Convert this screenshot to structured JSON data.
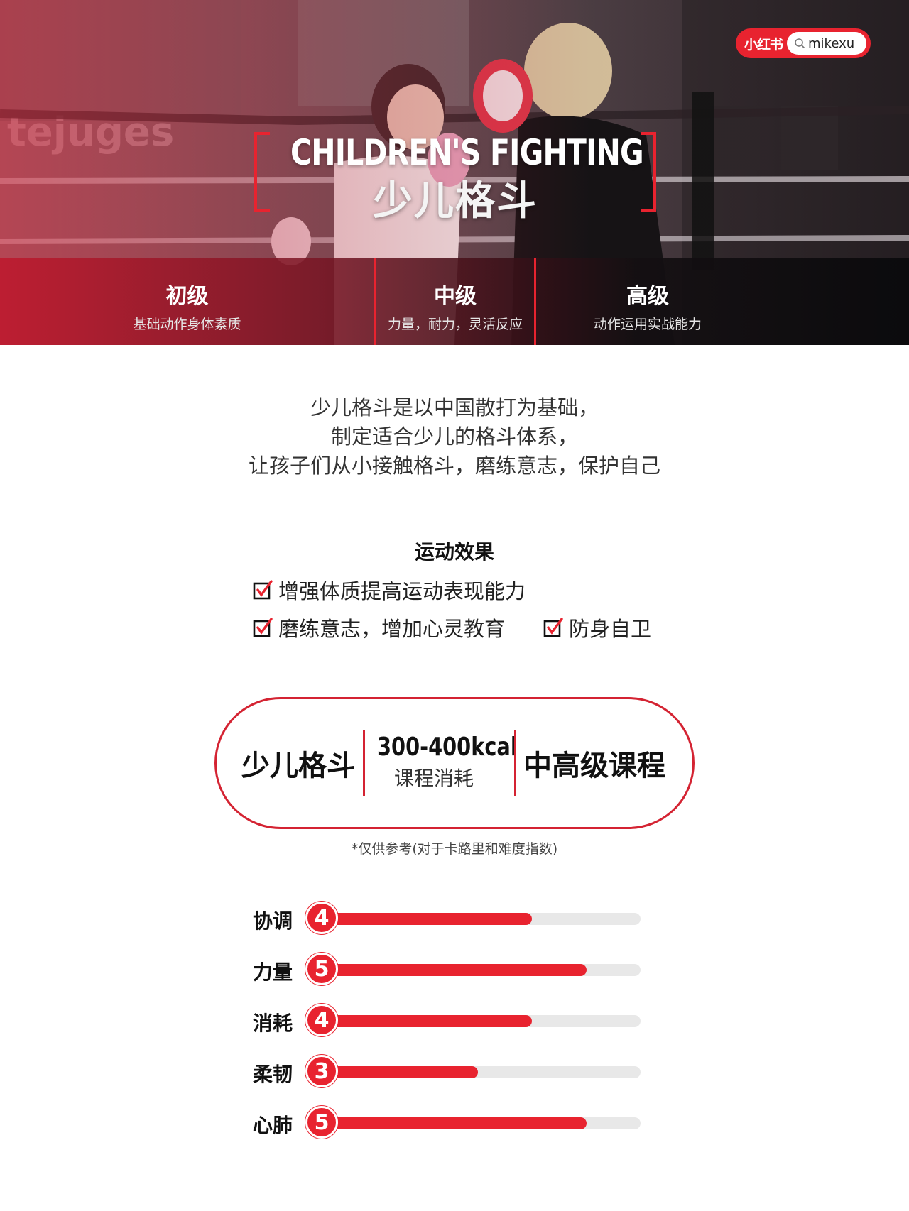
{
  "brand": {
    "logo": "小红书",
    "username": "mikexu"
  },
  "hero": {
    "title_en": "CHILDREN'S FIGHTING",
    "title_cn": "少儿格斗",
    "gym_sign": "tejuges"
  },
  "levels": [
    {
      "name": "初级",
      "desc": "基础动作身体素质"
    },
    {
      "name": "中级",
      "desc": "力量，耐力，灵活反应"
    },
    {
      "name": "高级",
      "desc": "动作运用实战能力"
    }
  ],
  "intro": {
    "line1": "少儿格斗是以中国散打为基础，",
    "line2": "制定适合少儿的格斗体系，",
    "line3": "让孩子们从小接触格斗，磨练意志，保护自己"
  },
  "effects": {
    "title": "运动效果",
    "items": [
      "增强体质提高运动表现能力",
      "磨练意志，增加心灵教育",
      "防身自卫"
    ]
  },
  "stats": {
    "course": "少儿格斗",
    "kcal": "300-400kcal",
    "kcal_label": "课程消耗",
    "level": "中高级课程",
    "footnote": "*仅供参考(对于卡路里和难度指数)"
  },
  "ratings": {
    "max": 6,
    "items": [
      {
        "label": "协调",
        "value": 4
      },
      {
        "label": "力量",
        "value": 5
      },
      {
        "label": "消耗",
        "value": 4
      },
      {
        "label": "柔韧",
        "value": 3
      },
      {
        "label": "心肺",
        "value": 5
      }
    ]
  },
  "colors": {
    "accent": "#e8232f",
    "text": "#1a1a1a",
    "track": "#e8e8e8"
  }
}
